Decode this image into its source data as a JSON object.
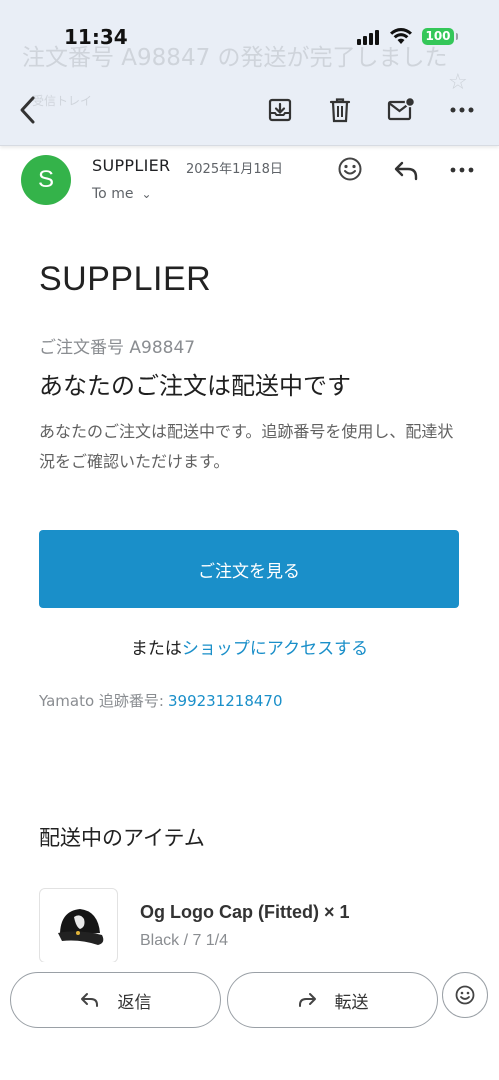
{
  "status_bar": {
    "time": "11:34",
    "battery": "100"
  },
  "ghost_header": {
    "subject": "注文番号 A98847 の発送が完了しました",
    "label": "受信トレイ"
  },
  "message": {
    "avatar_letter": "S",
    "sender": "SUPPLIER",
    "date": "2025年1月18日",
    "recipient": "To me"
  },
  "email": {
    "brand": "SUPPLIER",
    "order_number": "ご注文番号 A98847",
    "headline": "あなたのご注文は配送中です",
    "description": "あなたのご注文は配送中です。追跡番号を使用し、配達状況をご確認いただけます。",
    "cta_label": "ご注文を見る",
    "alt_prefix": "または",
    "alt_link": "ショップにアクセスする",
    "tracking_label": "Yamato 追跡番号:",
    "tracking_number": "399231218470",
    "section_title": "配送中のアイテム",
    "item": {
      "name": "Og Logo Cap (Fitted) × 1",
      "variant": "Black / 7 1/4"
    }
  },
  "actions": {
    "reply": "返信",
    "forward": "転送"
  },
  "colors": {
    "accent": "#1a8fc9",
    "avatar": "#34b34a",
    "battery": "#34c759"
  }
}
